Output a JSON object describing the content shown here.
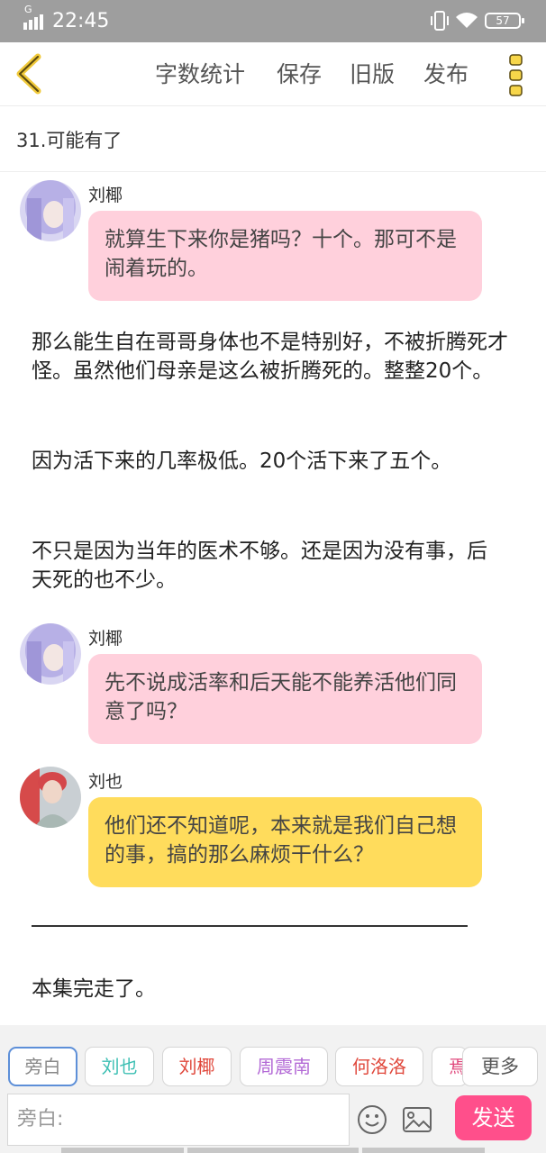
{
  "status_bar": {
    "network": "G",
    "time": "22:45",
    "battery": "57"
  },
  "toolbar": {
    "actions": [
      "字数统计",
      "保存",
      "旧版",
      "发布"
    ]
  },
  "chapter": {
    "title": "31.可能有了"
  },
  "messages": [
    {
      "type": "bubble",
      "sender": "刘椰",
      "color": "#ffd0dc",
      "text": "就算生下来你是猪吗？十个。那可不是闹着玩的。"
    },
    {
      "type": "narration",
      "text": "那么能生自在哥哥身体也不是特别好，不被折腾死才怪。虽然他们母亲是这么被折腾死的。整整20个。"
    },
    {
      "type": "narration",
      "text": "因为活下来的几率极低。20个活下来了五个。"
    },
    {
      "type": "narration",
      "text": "不只是因为当年的医术不够。还是因为没有事，后天死的也不少。"
    },
    {
      "type": "bubble",
      "sender": "刘椰",
      "color": "#ffd0dc",
      "text": "先不说成活率和后天能不能养活他们同意了吗？"
    },
    {
      "type": "bubble",
      "sender": "刘也",
      "color": "#ffdc5c",
      "text": "他们还不知道呢，本来就是我们自己想的事，搞的那么麻烦干什么？"
    },
    {
      "type": "narration",
      "text": "本集完走了。"
    }
  ],
  "characters": [
    {
      "name": "旁白",
      "color": "#888888",
      "selected": true
    },
    {
      "name": "刘也",
      "color": "#3cbfb3"
    },
    {
      "name": "刘椰",
      "color": "#e0483c"
    },
    {
      "name": "周震南",
      "color": "#b36ad6"
    },
    {
      "name": "何洛洛",
      "color": "#e0483c"
    },
    {
      "name": "焉",
      "color": "#e0487c"
    }
  ],
  "more_label": "更多",
  "composer": {
    "placeholder": "旁白:",
    "send_label": "发送"
  }
}
